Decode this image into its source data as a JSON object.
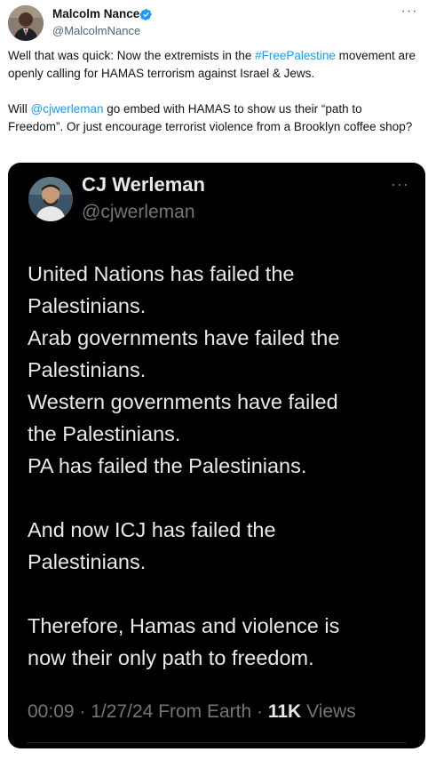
{
  "author": {
    "display_name": "Malcolm Nance",
    "handle": "@MalcolmNance",
    "verified_icon": "verified-badge-icon",
    "verified_color": "#1d9bf0"
  },
  "tweet": {
    "para1_before": "Well that was quick: Now the extremists in the ",
    "para1_hashtag": "#FreePalestine",
    "para1_after": " movement are openly calling for HAMAS terrorism against Israel & Jews.",
    "para2_before": "Will ",
    "para2_mention": "@cjwerleman",
    "para2_after": " go embed with HAMAS to show us their “path to Freedom”. Or just encourage terrorist violence from a Brooklyn coffee shop?"
  },
  "embedded": {
    "display_name": "CJ Werleman",
    "handle": "@cjwerleman",
    "body_lines": [
      "United Nations has failed the",
      "Palestinians.",
      "Arab governments have failed the",
      "Palestinians.",
      "Western governments have failed",
      "the Palestinians.",
      "PA has failed the Palestinians.",
      "",
      "And now ICJ has failed the",
      "Palestinians.",
      "",
      "Therefore, Hamas and violence is",
      "now their only path to freedom."
    ],
    "meta_time": "00:09",
    "meta_date": "1/27/24",
    "meta_source": "From Earth",
    "meta_views_count": "11K",
    "meta_views_label": "Views"
  },
  "colors": {
    "link": "#1d9bf0",
    "text": "#0f1419",
    "secondary": "#536471",
    "media_bg": "#000000"
  }
}
